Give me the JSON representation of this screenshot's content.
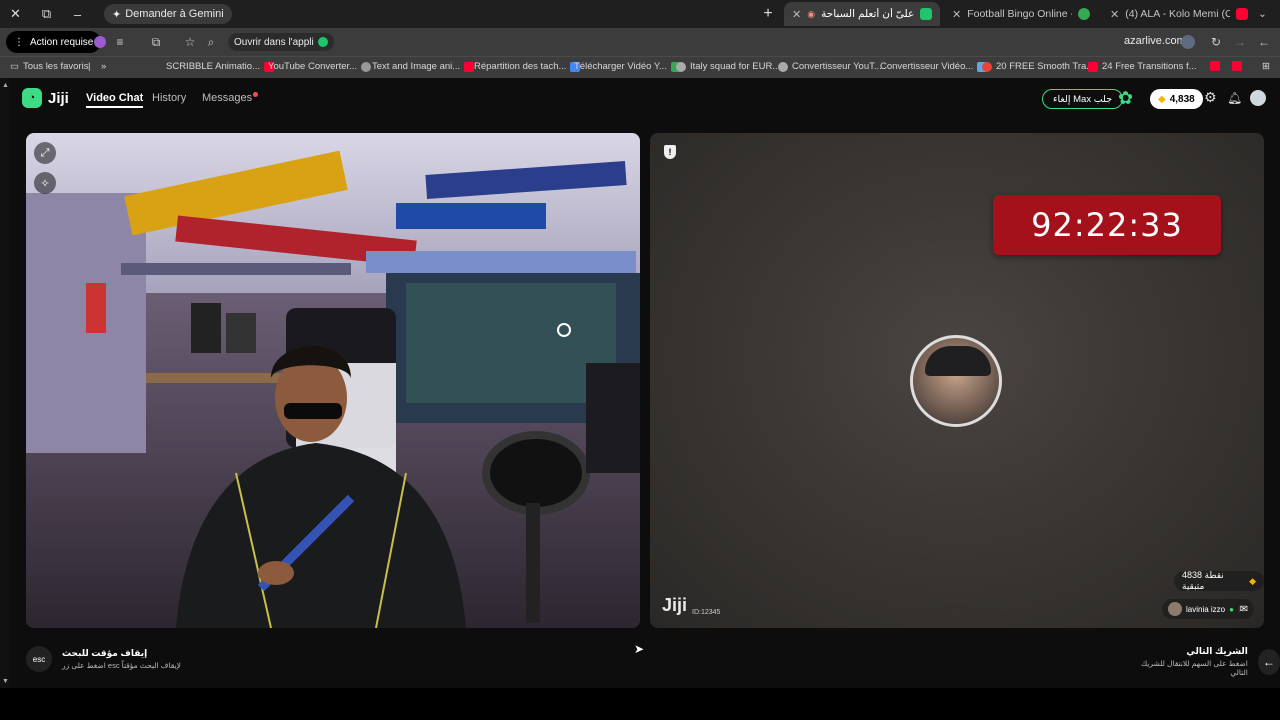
{
  "browser": {
    "window_controls": {
      "close": "✕",
      "restore": "⧉",
      "minimize": "–"
    },
    "gemini_label": "Demander à Gemini",
    "new_tab": "+",
    "tabs": [
      {
        "label": "(4) ALA - Kolo Memi (Official M...",
        "favicon_color": "#ff0033"
      },
      {
        "label": "Football Bingo Online - Play Ni...",
        "favicon_color": "#34a853"
      },
      {
        "label": "أيجب علىّ أن أتعلّم السباحة",
        "favicon_color": "#1fc46b"
      }
    ],
    "toolbar": {
      "action_label": "Action requise",
      "open_app_label": "Ouvrir dans l'appli",
      "url": "azarlive.com"
    },
    "bookmarks": [
      {
        "label": "Tous les favoris",
        "color": "#bdbdbd"
      },
      {
        "label": "SCRIBBLE Animatio...",
        "color": "#ff0033"
      },
      {
        "label": "YouTube Converter...",
        "color": "#ff0033"
      },
      {
        "label": "Text and Image ani...",
        "color": "#ff0033"
      },
      {
        "label": "Répartition des tach...",
        "color": "#4285f4"
      },
      {
        "label": "Télécharger Vidéo Y...",
        "color": "#34a853"
      },
      {
        "label": "Italy squad for EUR...",
        "color": "#aaaaaa"
      },
      {
        "label": "Convertisseur YouT...",
        "color": "#aaaaaa"
      },
      {
        "label": "Convertisseur Vidéo...",
        "color": "#5aa9e6"
      },
      {
        "label": "20 FREE Smooth Tra...",
        "color": "#ea4335"
      },
      {
        "label": "24 Free Transitions f...",
        "color": "#ff0033"
      }
    ]
  },
  "app": {
    "logo_text": "Jiji",
    "nav": {
      "video_chat": "Video Chat",
      "history": "History",
      "messages": "Messages"
    },
    "max_label": "إلغاء Max جلب",
    "coins": "4,838"
  },
  "right_panel": {
    "timer": "92:22:33",
    "gift_label": "4838 نقطة متبقية",
    "user_name": "lavinia izzo",
    "user_sub": "IT",
    "watermark": "Jiji",
    "watermark_id": "ID:12345"
  },
  "footer": {
    "esc_label": "esc",
    "left_title": "إيقاف مؤقت للبحث",
    "left_sub": "اضغط على زر esc لإيقاف البحث مؤقتاً",
    "right_title": "الشريك التالي",
    "right_sub": "اضغط على السهم للانتقال للشريك التالي"
  }
}
